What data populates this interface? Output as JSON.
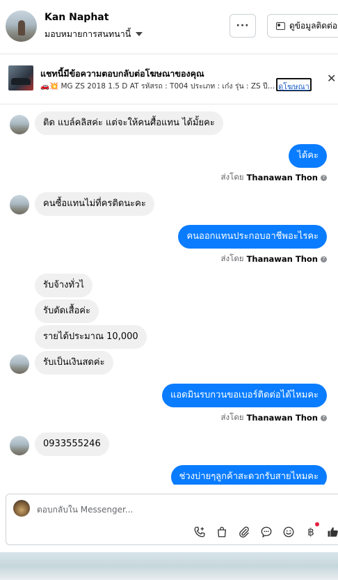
{
  "header": {
    "name": "Kan Naphat",
    "subtitle": "มอบหมายการสนทนานี้",
    "more_label": "···",
    "contact_label": "ดูข้อมูลติดต่อ"
  },
  "ad": {
    "title": "แชทนี้มีข้อความตอบกลับต่อโฆษณาของคุณ",
    "description": "🚗💥 MG ZS 2018 1.5 D AT รหัสรถ : T004 ประเภท : เก๋ง รุ่น : ZS ปี : 201...",
    "link_label": "ดูโฆษณา",
    "close_label": "✕"
  },
  "messages": {
    "m1": "ติด แบล์คลิสค่ะ แต่จะให้คนศื้อแทน ได้มั้ยคะ",
    "m2": "ได้คะ",
    "m3": "คนซื้อแทนไม่ที่ครติดนะคะ",
    "m4": "คนออกแทนประกอบอาชีพอะไรคะ",
    "m5": "รับจ้างทั่วไ",
    "m6": "รับตัดเสื้อค่ะ",
    "m7": "รายได้ประมาณ 10,000",
    "m8": "รับเป็นเงินสดค่ะ",
    "m9": "แอดมินรบกวนขอเบอร์ติดต่อได้ไหมคะ",
    "m10": "0933555246",
    "m11": "ช่วงบ่ายๆลูกค้าสะดวกรับสายไหมคะ"
  },
  "sent_by": {
    "prefix": "ส่งโดย",
    "name": "Thanawan Thon"
  },
  "composer": {
    "placeholder": "ตอบกลับใน Messenger..."
  }
}
